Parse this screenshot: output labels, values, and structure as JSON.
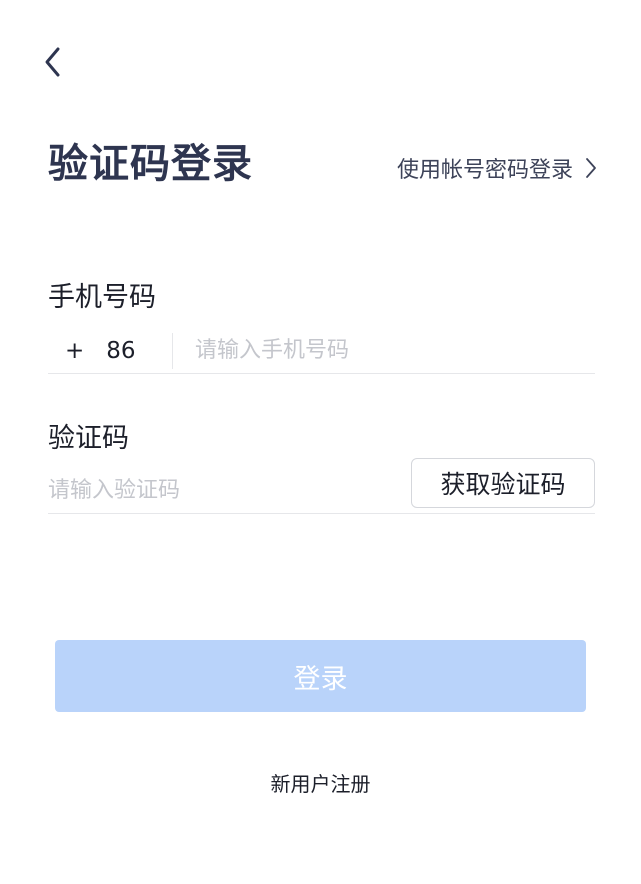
{
  "header": {
    "back_icon": "chevron-left-icon"
  },
  "title": "验证码登录",
  "switch_login": {
    "label": "使用帐号密码登录",
    "icon": "chevron-right-icon"
  },
  "phone": {
    "label": "手机号码",
    "country_plus": "+",
    "country_code": "86",
    "placeholder": "请输入手机号码",
    "value": ""
  },
  "code": {
    "label": "验证码",
    "placeholder": "请输入验证码",
    "value": "",
    "get_code_label": "获取验证码"
  },
  "login_button": {
    "label": "登录",
    "color": "#b9d3fa"
  },
  "register_link": "新用户注册",
  "colors": {
    "title": "#2e3550",
    "text": "#1c1f2a",
    "placeholder": "#c4c6cc",
    "divider": "#e6e7ea"
  }
}
